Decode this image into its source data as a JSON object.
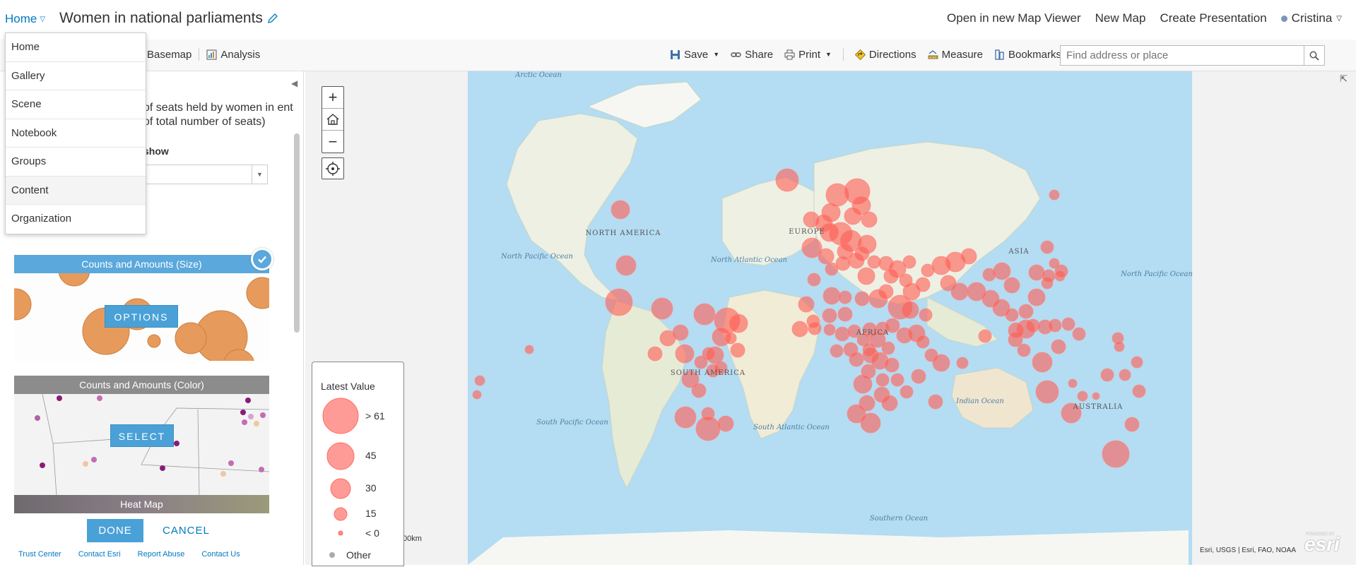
{
  "header": {
    "home_label": "Home",
    "map_title": "Women in national parliaments",
    "actions": [
      "Open in new Map Viewer",
      "New Map",
      "Create Presentation"
    ],
    "user_name": "Cristina"
  },
  "home_menu": {
    "items": [
      "Home",
      "Gallery",
      "Scene",
      "Notebook",
      "Groups",
      "Content",
      "Organization"
    ]
  },
  "toolbar": {
    "basemap": "Basemap",
    "analysis": "Analysis",
    "save": "Save",
    "share": "Share",
    "print": "Print",
    "directions": "Directions",
    "measure": "Measure",
    "bookmarks": "Bookmarks",
    "search_placeholder": "Find address or place"
  },
  "side_panel": {
    "description": "of seats held by women in ent of total number of seats)",
    "attribute_label": "show",
    "cards": [
      {
        "title": "Counts and Amounts (Size)",
        "button": "OPTIONS",
        "selected": true,
        "header_color": "#5aa8dc"
      },
      {
        "title": "Counts and Amounts (Color)",
        "button": "SELECT",
        "selected": false,
        "header_color": "#8c8c8c"
      },
      {
        "title": "Heat Map",
        "button": "",
        "selected": false,
        "header_color": "#7a6e72"
      }
    ],
    "done": "DONE",
    "cancel": "CANCEL",
    "footer_links": [
      "Trust Center",
      "Contact Esri",
      "Report Abuse",
      "Contact Us"
    ]
  },
  "map": {
    "labels": {
      "arctic": "Arctic Ocean",
      "north_america": "NORTH AMERICA",
      "north_pacific_left": "North Pacific Ocean",
      "north_atlantic": "North Atlantic Ocean",
      "europe": "EUROPE",
      "asia": "ASIA",
      "africa": "AFRICA",
      "south_america": "SOUTH AMERICA",
      "south_pacific": "South Pacific Ocean",
      "south_atlantic": "South Atlantic Ocean",
      "indian": "Indian Ocean",
      "australia": "AUSTRALIA",
      "north_pacific_right": "North Pacific Ocean",
      "southern": "Southern Ocean"
    },
    "marker_color": "#ff5b52",
    "scale_text": "00km",
    "attribution": "Esri, USGS | Esri, FAO, NOAA",
    "logo_text": "esri",
    "logo_small": "POWERED BY"
  },
  "legend": {
    "title": "Latest Value",
    "entries": [
      "> 61",
      "45",
      "30",
      "15",
      "< 0"
    ],
    "other": "Other"
  }
}
